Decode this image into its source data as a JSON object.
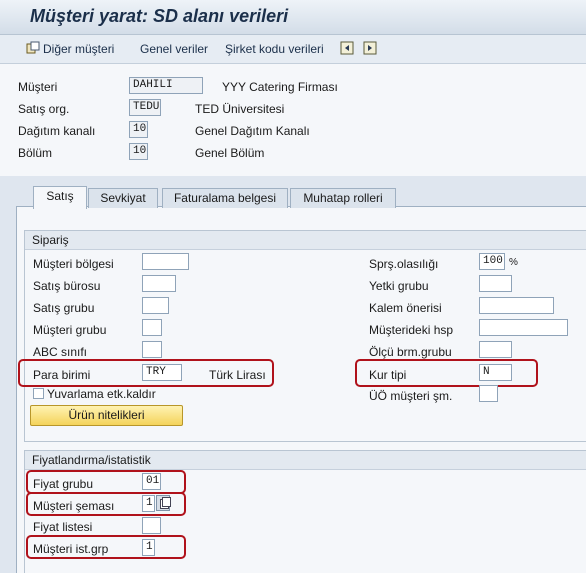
{
  "window": {
    "title": "Müşteri yarat: SD alanı verileri"
  },
  "toolbar": {
    "other_customer": "Diğer müşteri",
    "general_data": "Genel veriler",
    "company_code_data": "Şirket kodu verileri"
  },
  "header": {
    "customer": {
      "label": "Müşteri",
      "value": "DAHILI",
      "text": "YYY Catering Firması"
    },
    "sales_org": {
      "label": "Satış org.",
      "value": "TEDU",
      "text": "TED Üniversitesi"
    },
    "dist_channel": {
      "label": "Dağıtım kanalı",
      "value": "10",
      "text": "Genel Dağıtım Kanalı"
    },
    "division": {
      "label": "Bölüm",
      "value": "10",
      "text": "Genel Bölüm"
    }
  },
  "tabs": [
    {
      "label": "Satış",
      "active": true
    },
    {
      "label": "Sevkiyat"
    },
    {
      "label": "Faturalama belgesi"
    },
    {
      "label": "Muhatap rolleri"
    }
  ],
  "order_group": {
    "title": "Sipariş",
    "left": {
      "sales_district": {
        "label": "Müşteri bölgesi",
        "value": ""
      },
      "sales_office": {
        "label": "Satış bürosu",
        "value": ""
      },
      "sales_group": {
        "label": "Satış grubu",
        "value": ""
      },
      "customer_group": {
        "label": "Müşteri grubu",
        "value": ""
      },
      "abc_class": {
        "label": "ABC sınıfı",
        "value": ""
      },
      "currency": {
        "label": "Para birimi",
        "value": "TRY",
        "text": "Türk Lirası"
      },
      "rounding_checkbox": {
        "label": "Yuvarlama etk.kaldır",
        "checked": false
      }
    },
    "right": {
      "order_probability": {
        "label": "Sprş.olasılığı",
        "value": "100",
        "unit": "%"
      },
      "authorization_group": {
        "label": "Yetki grubu",
        "value": ""
      },
      "item_proposal": {
        "label": "Kalem önerisi",
        "value": ""
      },
      "account_at_customer": {
        "label": "Müşterideki hsp",
        "value": ""
      },
      "unit_group": {
        "label": "Ölçü brm.grubu",
        "value": ""
      },
      "exchange_rate_type": {
        "label": "Kur tipi",
        "value": "N"
      },
      "pp_customer_proc": {
        "label": "ÜÖ müşteri şm.",
        "value": ""
      }
    },
    "product_attributes_button": "Ürün nitelikleri"
  },
  "pricing_group": {
    "title": "Fiyatlandırma/istatistik",
    "price_group": {
      "label": "Fiyat grubu",
      "value": "01"
    },
    "customer_pricing_procedure": {
      "label": "Müşteri şeması",
      "value": "1"
    },
    "price_list": {
      "label": "Fiyat listesi",
      "value": ""
    },
    "customer_statistics_group": {
      "label": "Müşteri ist.grp",
      "value": "1"
    }
  },
  "colors": {
    "highlight": "#b0121b",
    "button_fill": "#f4d35b",
    "title": "#1b2f4a"
  }
}
